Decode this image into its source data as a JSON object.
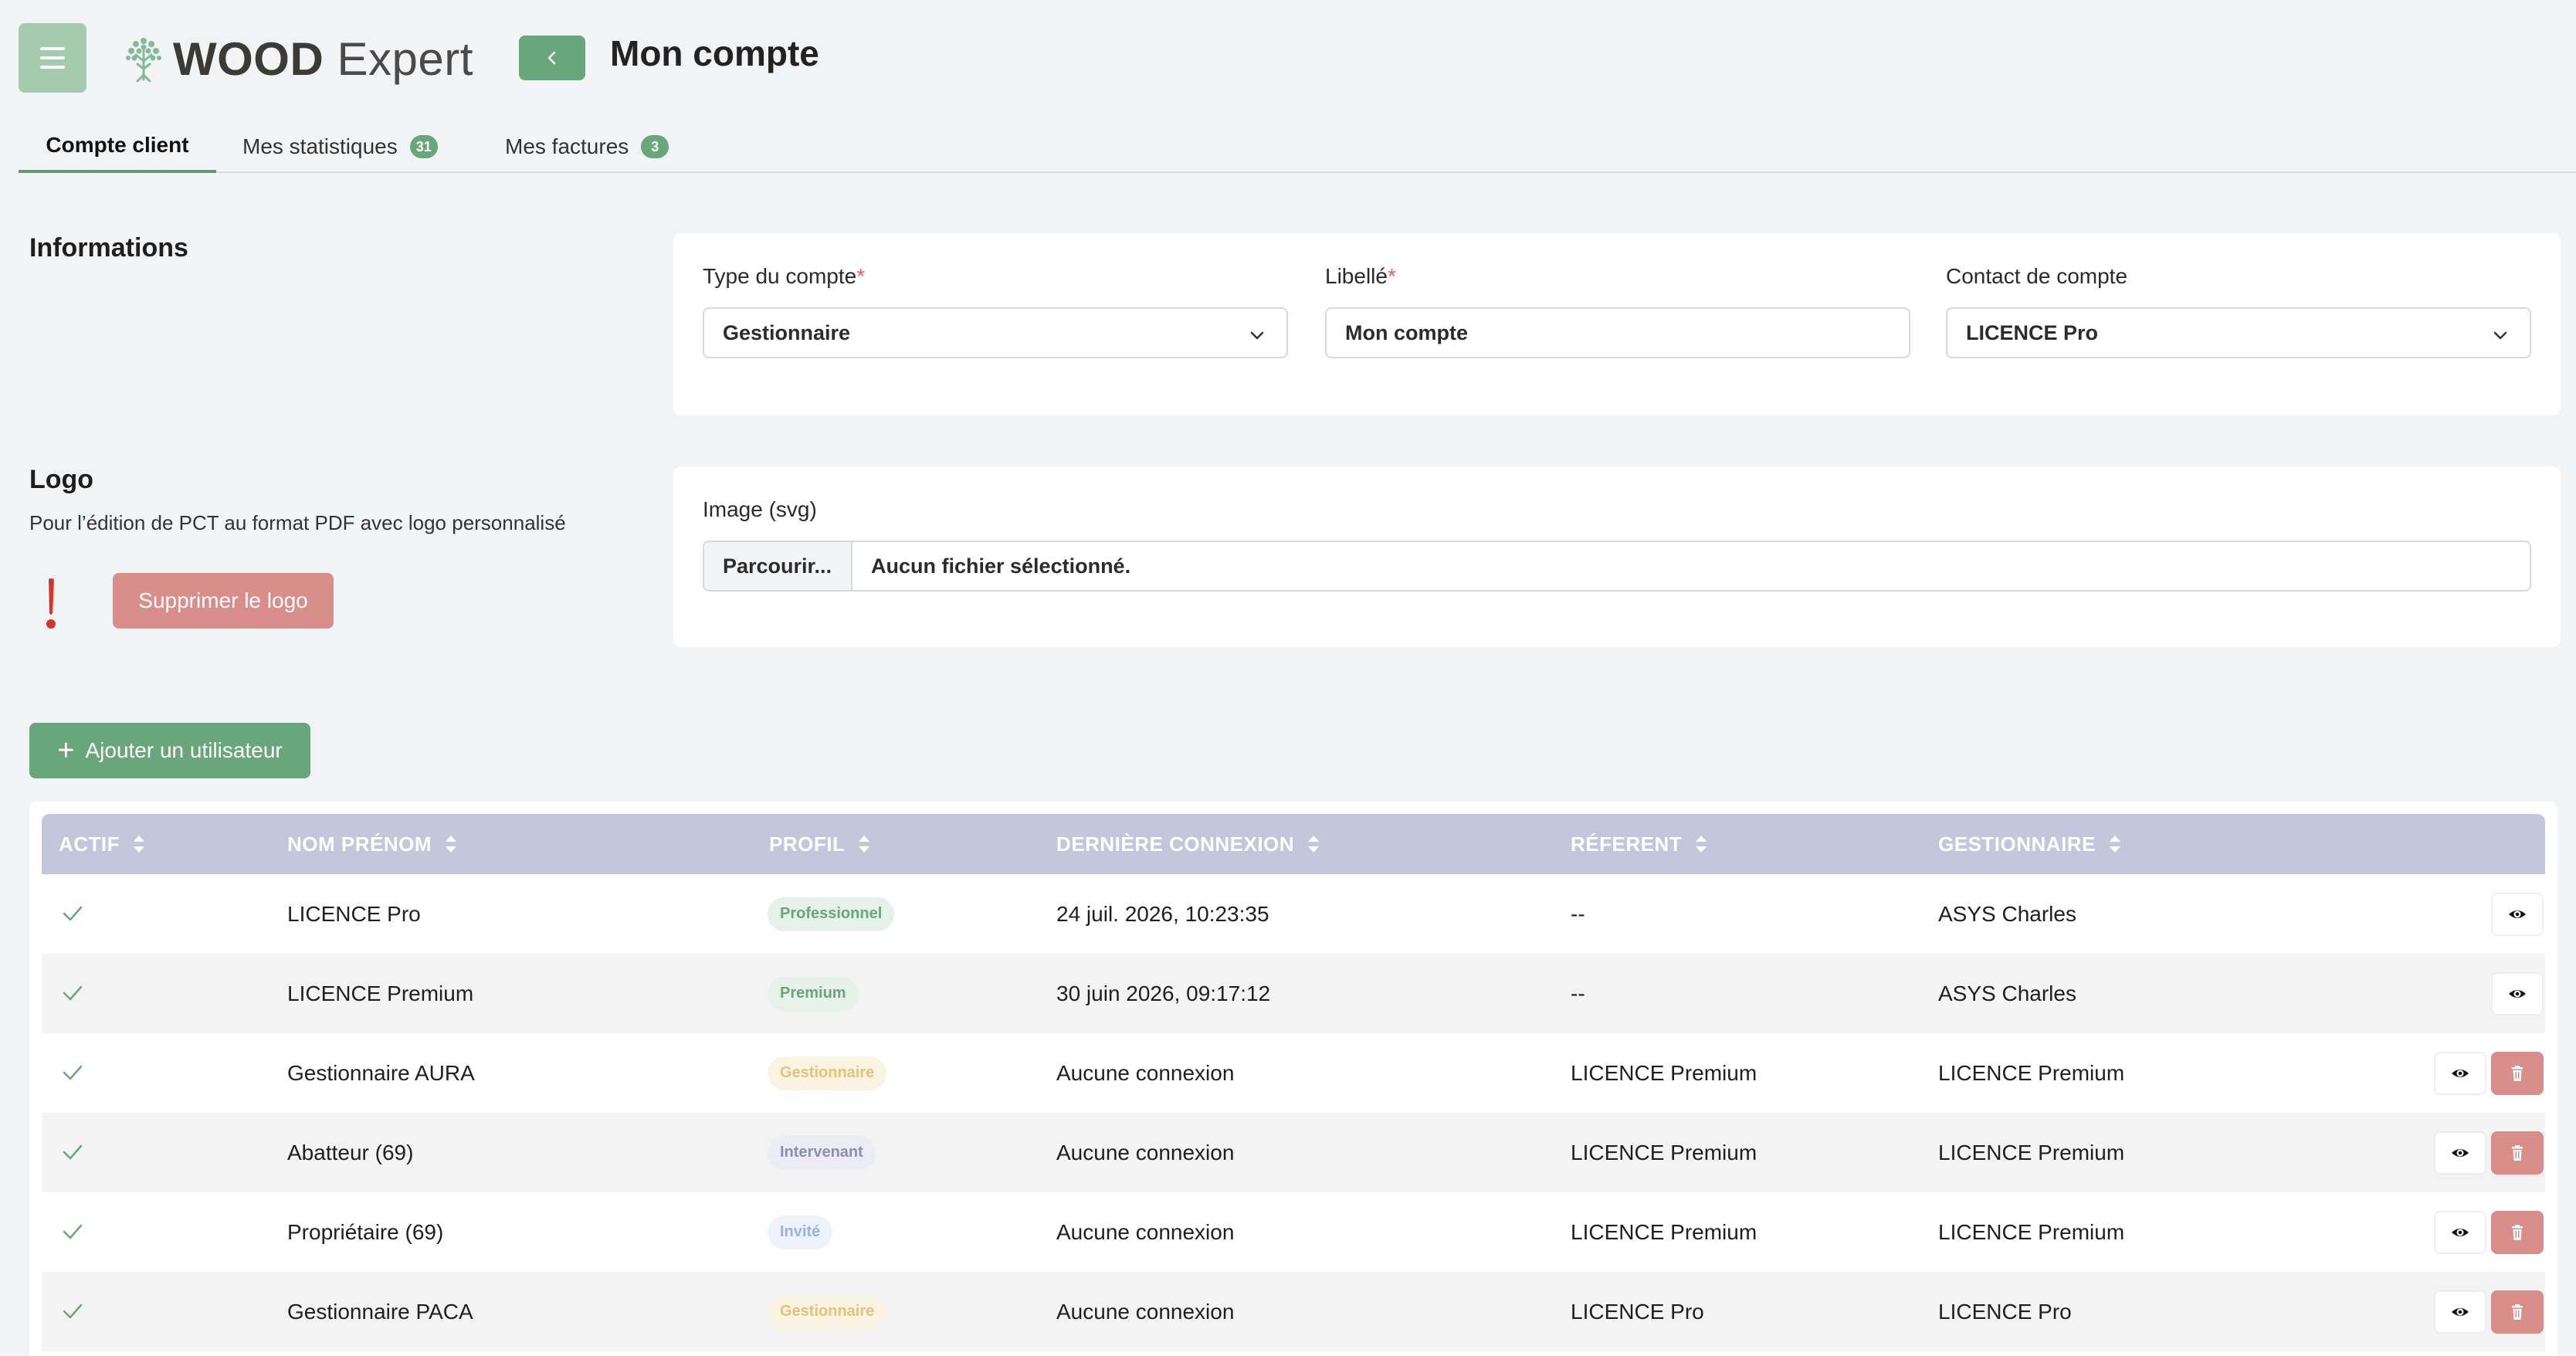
{
  "header": {
    "brand_bold": "WOOD",
    "brand_light": "Expert",
    "page_title": "Mon compte"
  },
  "tabs": [
    {
      "label": "Compte client",
      "active": true,
      "count": null
    },
    {
      "label": "Mes statistiques",
      "active": false,
      "count": "31"
    },
    {
      "label": "Mes factures",
      "active": false,
      "count": "3"
    }
  ],
  "informations": {
    "title": "Informations",
    "account_type": {
      "label": "Type du compte",
      "required_mark": "*",
      "value": "Gestionnaire"
    },
    "libelle": {
      "label": "Libellé",
      "required_mark": "*",
      "value": "Mon compte"
    },
    "contact": {
      "label": "Contact de compte",
      "value": "LICENCE Pro"
    }
  },
  "logo_section": {
    "title": "Logo",
    "description": "Pour l’édition de PCT au format PDF avec logo personnalisé",
    "delete_button": "Supprimer le logo",
    "image_label": "Image (svg)",
    "browse_button": "Parcourir...",
    "file_name": "Aucun fichier sélectionné."
  },
  "add_user_button": "Ajouter un utilisateur",
  "table": {
    "columns": [
      "ACTIF",
      "NOM PRÉNOM",
      "PROFIL",
      "DERNIÈRE CONNEXION",
      "RÉFERENT",
      "GESTIONNAIRE"
    ],
    "rows": [
      {
        "active": true,
        "name": "LICENCE Pro",
        "profile": "Professionnel",
        "profile_color": "#6aa67b",
        "profile_bg": "#e6f1e9",
        "last_login": "24 juil. 2026, 10:23:35",
        "referent": "--",
        "manager": "ASYS Charles",
        "deletable": false
      },
      {
        "active": true,
        "name": "LICENCE Premium",
        "profile": "Premium",
        "profile_color": "#6aa67b",
        "profile_bg": "#e6f1e9",
        "last_login": "30 juin 2026, 09:17:12",
        "referent": "--",
        "manager": "ASYS Charles",
        "deletable": false
      },
      {
        "active": true,
        "name": "Gestionnaire AURA",
        "profile": "Gestionnaire",
        "profile_color": "#e3c27a",
        "profile_bg": "#fbf3e2",
        "last_login": "Aucune connexion",
        "referent": "LICENCE Premium",
        "manager": "LICENCE Premium",
        "deletable": true
      },
      {
        "active": true,
        "name": "Abatteur (69)",
        "profile": "Intervenant",
        "profile_color": "#8b8fb8",
        "profile_bg": "#ebecf4",
        "last_login": "Aucune connexion",
        "referent": "LICENCE Premium",
        "manager": "LICENCE Premium",
        "deletable": true
      },
      {
        "active": true,
        "name": "Propriétaire (69)",
        "profile": "Invité",
        "profile_color": "#9bb2e0",
        "profile_bg": "#eef2fb",
        "last_login": "Aucune connexion",
        "referent": "LICENCE Premium",
        "manager": "LICENCE Premium",
        "deletable": true
      },
      {
        "active": true,
        "name": "Gestionnaire PACA",
        "profile": "Gestionnaire",
        "profile_color": "#e3c27a",
        "profile_bg": "#fbf3e2",
        "last_login": "Aucune connexion",
        "referent": "LICENCE Pro",
        "manager": "LICENCE Pro",
        "deletable": true
      }
    ]
  },
  "colors": {
    "accent": "#6aa67b",
    "danger": "#d98e8b",
    "table_header": "#c4c7dc"
  }
}
